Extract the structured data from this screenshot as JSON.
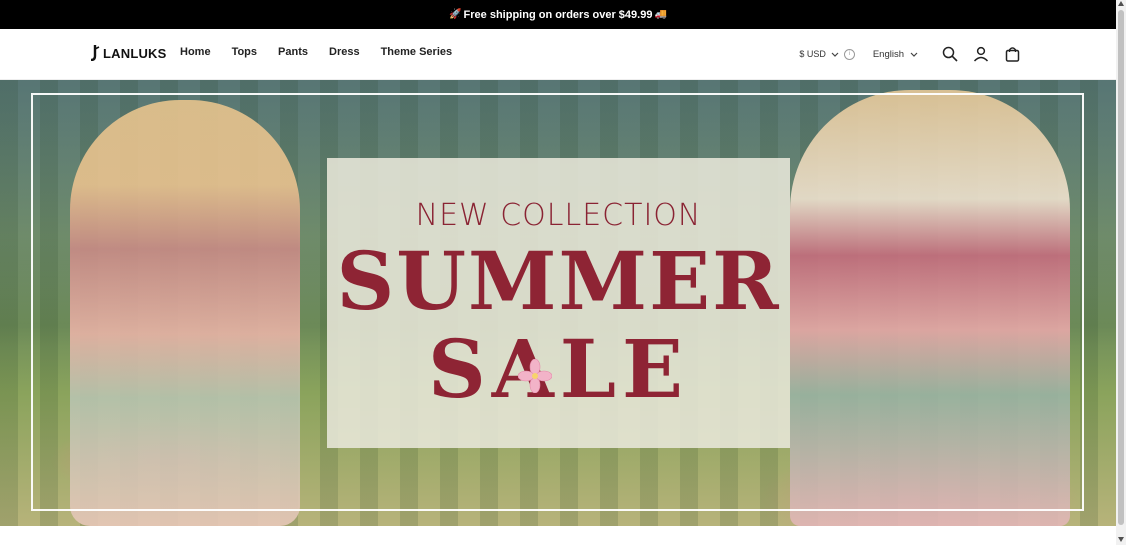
{
  "announcement": {
    "emoji_left": "🚀",
    "text": "Free shipping on orders over $49.99",
    "emoji_right": "🚚"
  },
  "header": {
    "logo_text": "LANLUKS",
    "nav": [
      "Home",
      "Tops",
      "Pants",
      "Dress",
      "Theme Series"
    ],
    "currency": "$ USD",
    "language": "English",
    "icons": [
      "search-icon",
      "account-icon",
      "cart-icon"
    ]
  },
  "hero": {
    "kicker": "NEW COLLECTION",
    "headline_1": "SUMMER",
    "headline_2": "SALE"
  },
  "colors": {
    "announcement_bg": "#000000",
    "headline": "#8e2434",
    "promo_bg": "#e8e7da"
  }
}
